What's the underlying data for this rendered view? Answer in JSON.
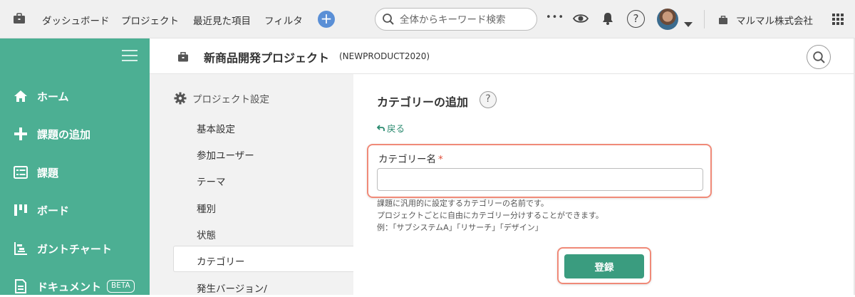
{
  "topbar": {
    "nav": [
      "ダッシュボード",
      "プロジェクト",
      "最近見た項目",
      "フィルタ"
    ],
    "add_symbol": "+",
    "search_placeholder": "全体からキーワード検索",
    "more_symbol": "•••",
    "help_symbol": "?",
    "company": "マルマル株式会社"
  },
  "sidebar": {
    "items": [
      {
        "label": "ホーム",
        "icon": "home-icon"
      },
      {
        "label": "課題の追加",
        "icon": "plus-icon"
      },
      {
        "label": "課題",
        "icon": "list-icon"
      },
      {
        "label": "ボード",
        "icon": "board-icon"
      },
      {
        "label": "ガントチャート",
        "icon": "gantt-icon"
      },
      {
        "label": "ドキュメント",
        "icon": "document-icon",
        "badge": "BETA"
      }
    ]
  },
  "project": {
    "title": "新商品開発プロジェクト",
    "key": "(NEWPRODUCT2020)"
  },
  "settings": {
    "heading": "プロジェクト設定",
    "items": [
      "基本設定",
      "参加ユーザー",
      "テーマ",
      "種別",
      "状態",
      "カテゴリー",
      "発生バージョン/"
    ],
    "active": "カテゴリー"
  },
  "form": {
    "heading": "カテゴリーの追加",
    "help": "?",
    "back": "戻る",
    "label": "カテゴリー名",
    "required_mark": "*",
    "value": "",
    "hints": [
      "課題に汎用的に設定するカテゴリーの名前です。",
      "プロジェクトごとに自由にカテゴリー分けすることができます。",
      "例：「サブシステムA」「リサーチ」「デザイン」"
    ],
    "submit": "登録"
  },
  "colors": {
    "sidebar": "#4caf93",
    "primary_button": "#3a9c7f",
    "highlight": "#f08a78",
    "link": "#2a8a6f"
  }
}
